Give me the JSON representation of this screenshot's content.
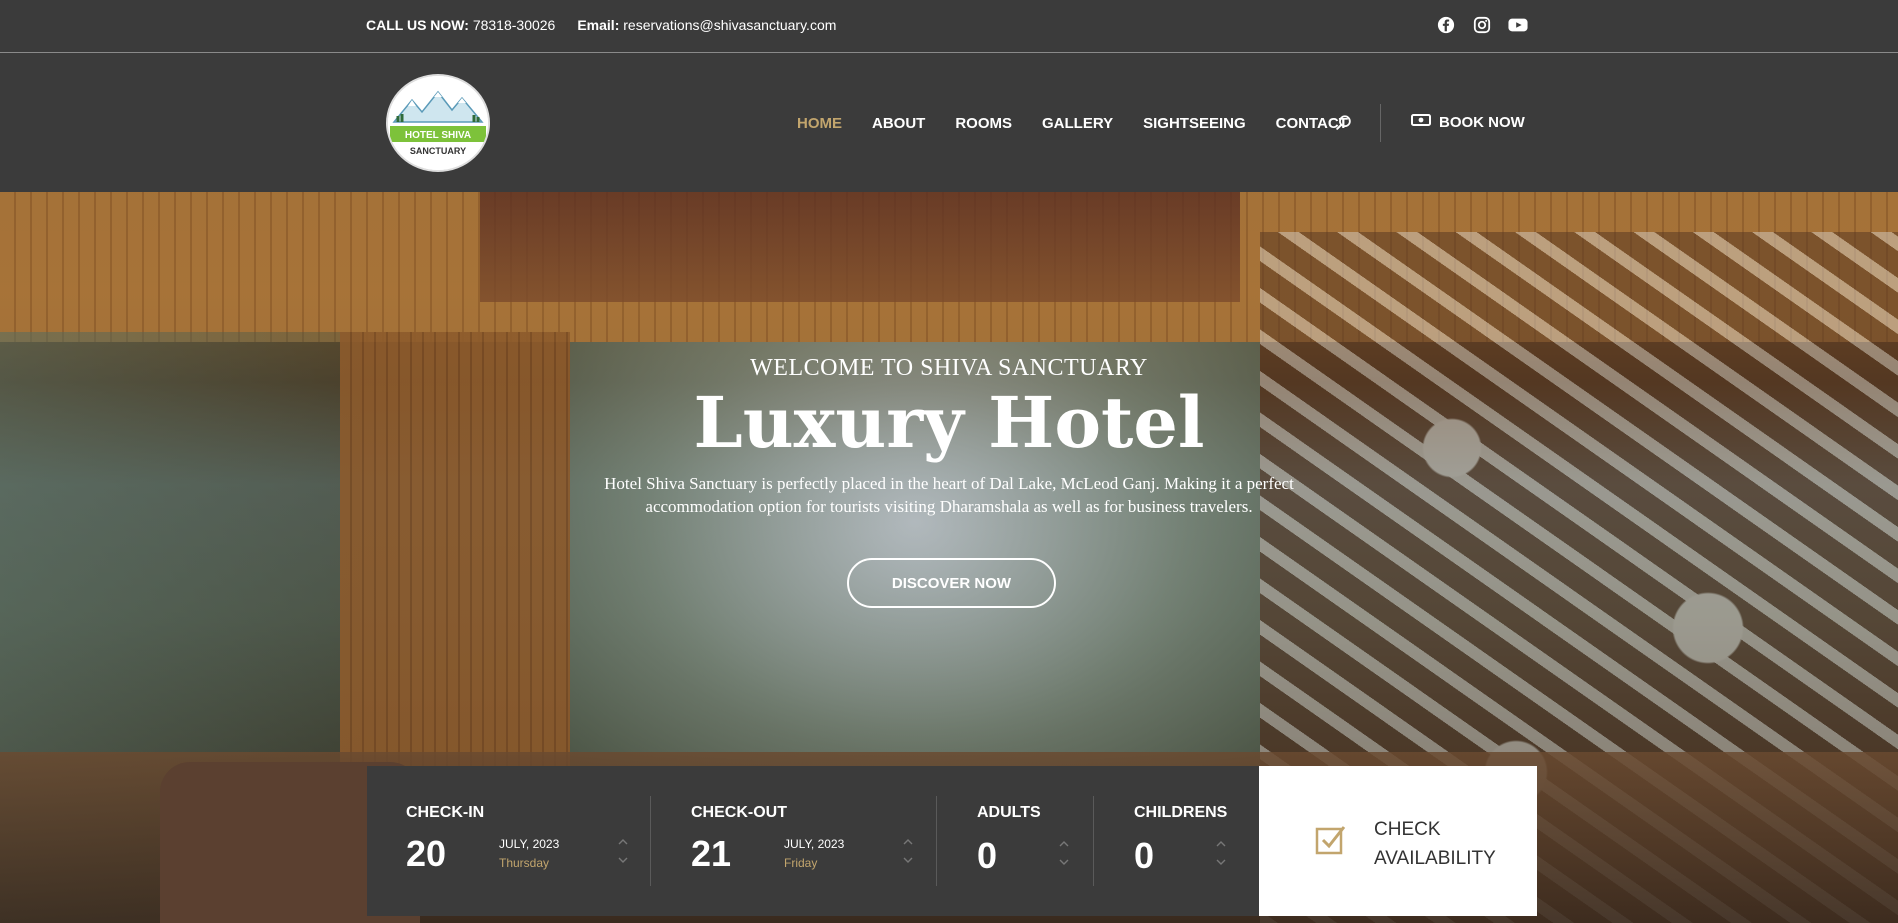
{
  "topbar": {
    "call_label": "CALL US NOW:",
    "phone": "78318-30026",
    "email_label": "Email:",
    "email": "reservations@shivasanctuary.com",
    "social": [
      "facebook-icon",
      "instagram-icon",
      "youtube-icon"
    ]
  },
  "logo": {
    "line1": "HOTEL SHIVA",
    "line2": "SANCTUARY"
  },
  "nav": {
    "items": [
      {
        "label": "HOME",
        "active": true
      },
      {
        "label": "ABOUT"
      },
      {
        "label": "ROOMS"
      },
      {
        "label": "GALLERY"
      },
      {
        "label": "SIGHTSEEING"
      },
      {
        "label": "CONTACT"
      }
    ],
    "book_now": "BOOK NOW"
  },
  "hero": {
    "welcome": "WELCOME TO SHIVA SANCTUARY",
    "title": "Luxury Hotel",
    "description": "Hotel Shiva Sanctuary is perfectly placed in the heart of Dal Lake, McLeod Ganj. Making it a perfect accommodation option for tourists visiting Dharamshala as well as for business travelers.",
    "cta": "DISCOVER NOW"
  },
  "booking": {
    "checkin": {
      "label": "CHECK-IN",
      "day": "20",
      "month": "JULY, 2023",
      "weekday": "Thursday"
    },
    "checkout": {
      "label": "CHECK-OUT",
      "day": "21",
      "month": "JULY, 2023",
      "weekday": "Friday"
    },
    "adults": {
      "label": "ADULTS",
      "value": "0"
    },
    "children": {
      "label": "CHILDRENS",
      "value": "0"
    },
    "check_line1": "CHECK",
    "check_line2": "AVAILABILITY"
  },
  "colors": {
    "accent": "#c2a56d",
    "bar": "#3b3b3b",
    "logo_green": "#7dc23a"
  }
}
